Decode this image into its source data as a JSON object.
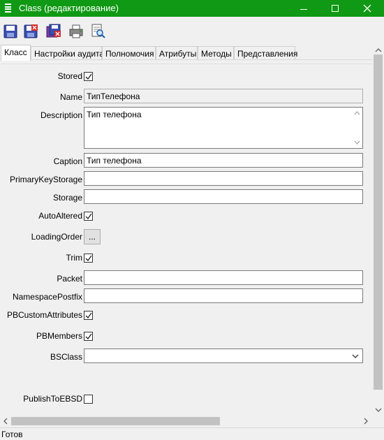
{
  "window": {
    "title": "Class (редактирование)"
  },
  "toolbar": {
    "buttons": [
      "save-icon",
      "save-close-icon",
      "save-copy-icon",
      "print-icon",
      "preview-icon"
    ]
  },
  "tabs": [
    {
      "label": "Класс",
      "active": true
    },
    {
      "label": "Настройки аудита",
      "active": false
    },
    {
      "label": "Полномочия",
      "active": false
    },
    {
      "label": "Атрибуты",
      "active": false
    },
    {
      "label": "Методы",
      "active": false
    },
    {
      "label": "Представления",
      "active": false
    }
  ],
  "form": {
    "stored": {
      "label": "Stored",
      "checked": true
    },
    "name": {
      "label": "Name",
      "value": "ТипТелефона"
    },
    "description": {
      "label": "Description",
      "value": "Тип телефона"
    },
    "caption": {
      "label": "Caption",
      "value": "Тип телефона"
    },
    "primary_key_storage": {
      "label": "PrimaryKeyStorage",
      "value": ""
    },
    "storage": {
      "label": "Storage",
      "value": ""
    },
    "auto_altered": {
      "label": "AutoAltered",
      "checked": true
    },
    "loading_order": {
      "label": "LoadingOrder",
      "button": "..."
    },
    "trim": {
      "label": "Trim",
      "checked": true
    },
    "packet": {
      "label": "Packet",
      "value": ""
    },
    "namespace_postfix": {
      "label": "NamespacePostfix",
      "value": ""
    },
    "pb_custom_attributes": {
      "label": "PBCustomAttributes",
      "checked": true
    },
    "pb_members": {
      "label": "PBMembers",
      "checked": true
    },
    "bs_class": {
      "label": "BSClass",
      "value": ""
    },
    "publish_to_ebsd": {
      "label": "PublishToEBSD",
      "checked": false
    }
  },
  "status": {
    "text": "Готов"
  },
  "colors": {
    "titlebar": "#0f9914"
  }
}
